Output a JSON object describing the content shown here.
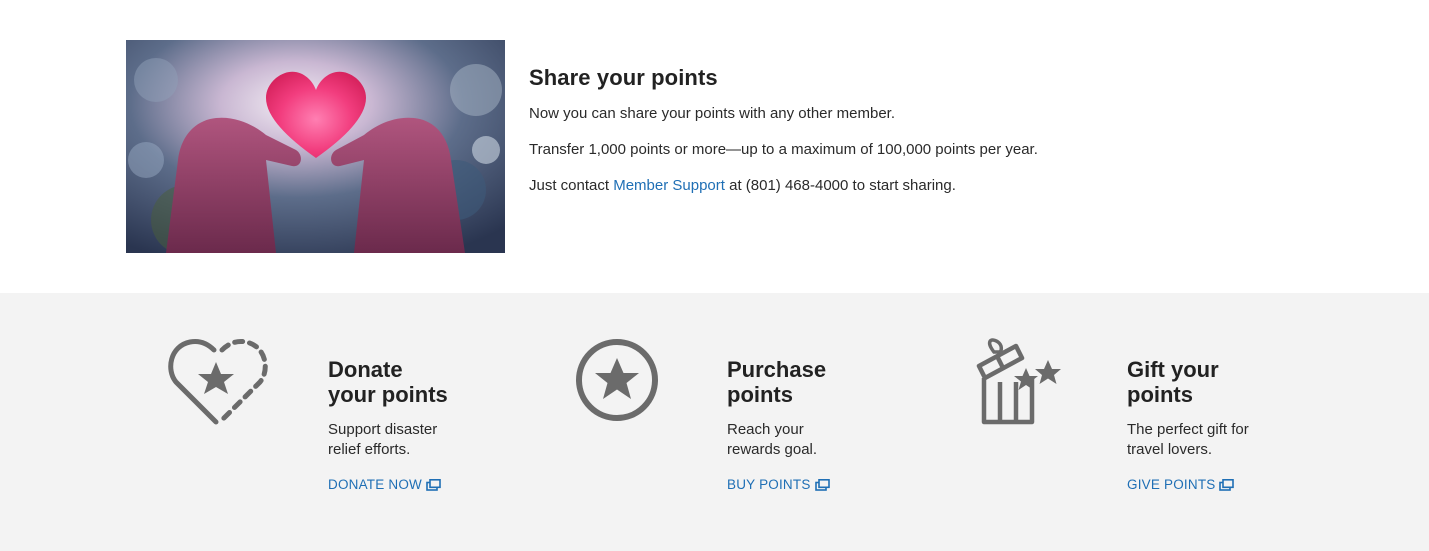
{
  "share": {
    "title": "Share your points",
    "line1": "Now you can share your points with any other member.",
    "line2": "Transfer 1,000 points or more—up to a maximum of 100,000 points per year.",
    "line3_prefix": "Just contact ",
    "line3_link": "Member Support",
    "line3_suffix": " at (801) 468-4000 to start sharing.",
    "image_icon": "hands-holding-heart-photo"
  },
  "features": [
    {
      "icon": "heart-star-icon",
      "title_line1": "Donate",
      "title_line2": "your points",
      "desc_line1": "Support disaster",
      "desc_line2": "relief efforts.",
      "cta": "DONATE NOW"
    },
    {
      "icon": "star-circle-icon",
      "title_line1": "Purchase",
      "title_line2": "points",
      "desc_line1": "Reach your",
      "desc_line2": "rewards goal.",
      "cta": "BUY POINTS"
    },
    {
      "icon": "gift-box-stars-icon",
      "title_line1": "Gift your",
      "title_line2": "points",
      "desc_line1": "The perfect gift for",
      "desc_line2": "travel lovers.",
      "cta": "GIVE POINTS"
    }
  ],
  "colors": {
    "link": "#1f6fb5",
    "icon_gray": "#6b6b6b",
    "band_bg": "#f3f3f3",
    "heart_pink": "#f0407a"
  }
}
